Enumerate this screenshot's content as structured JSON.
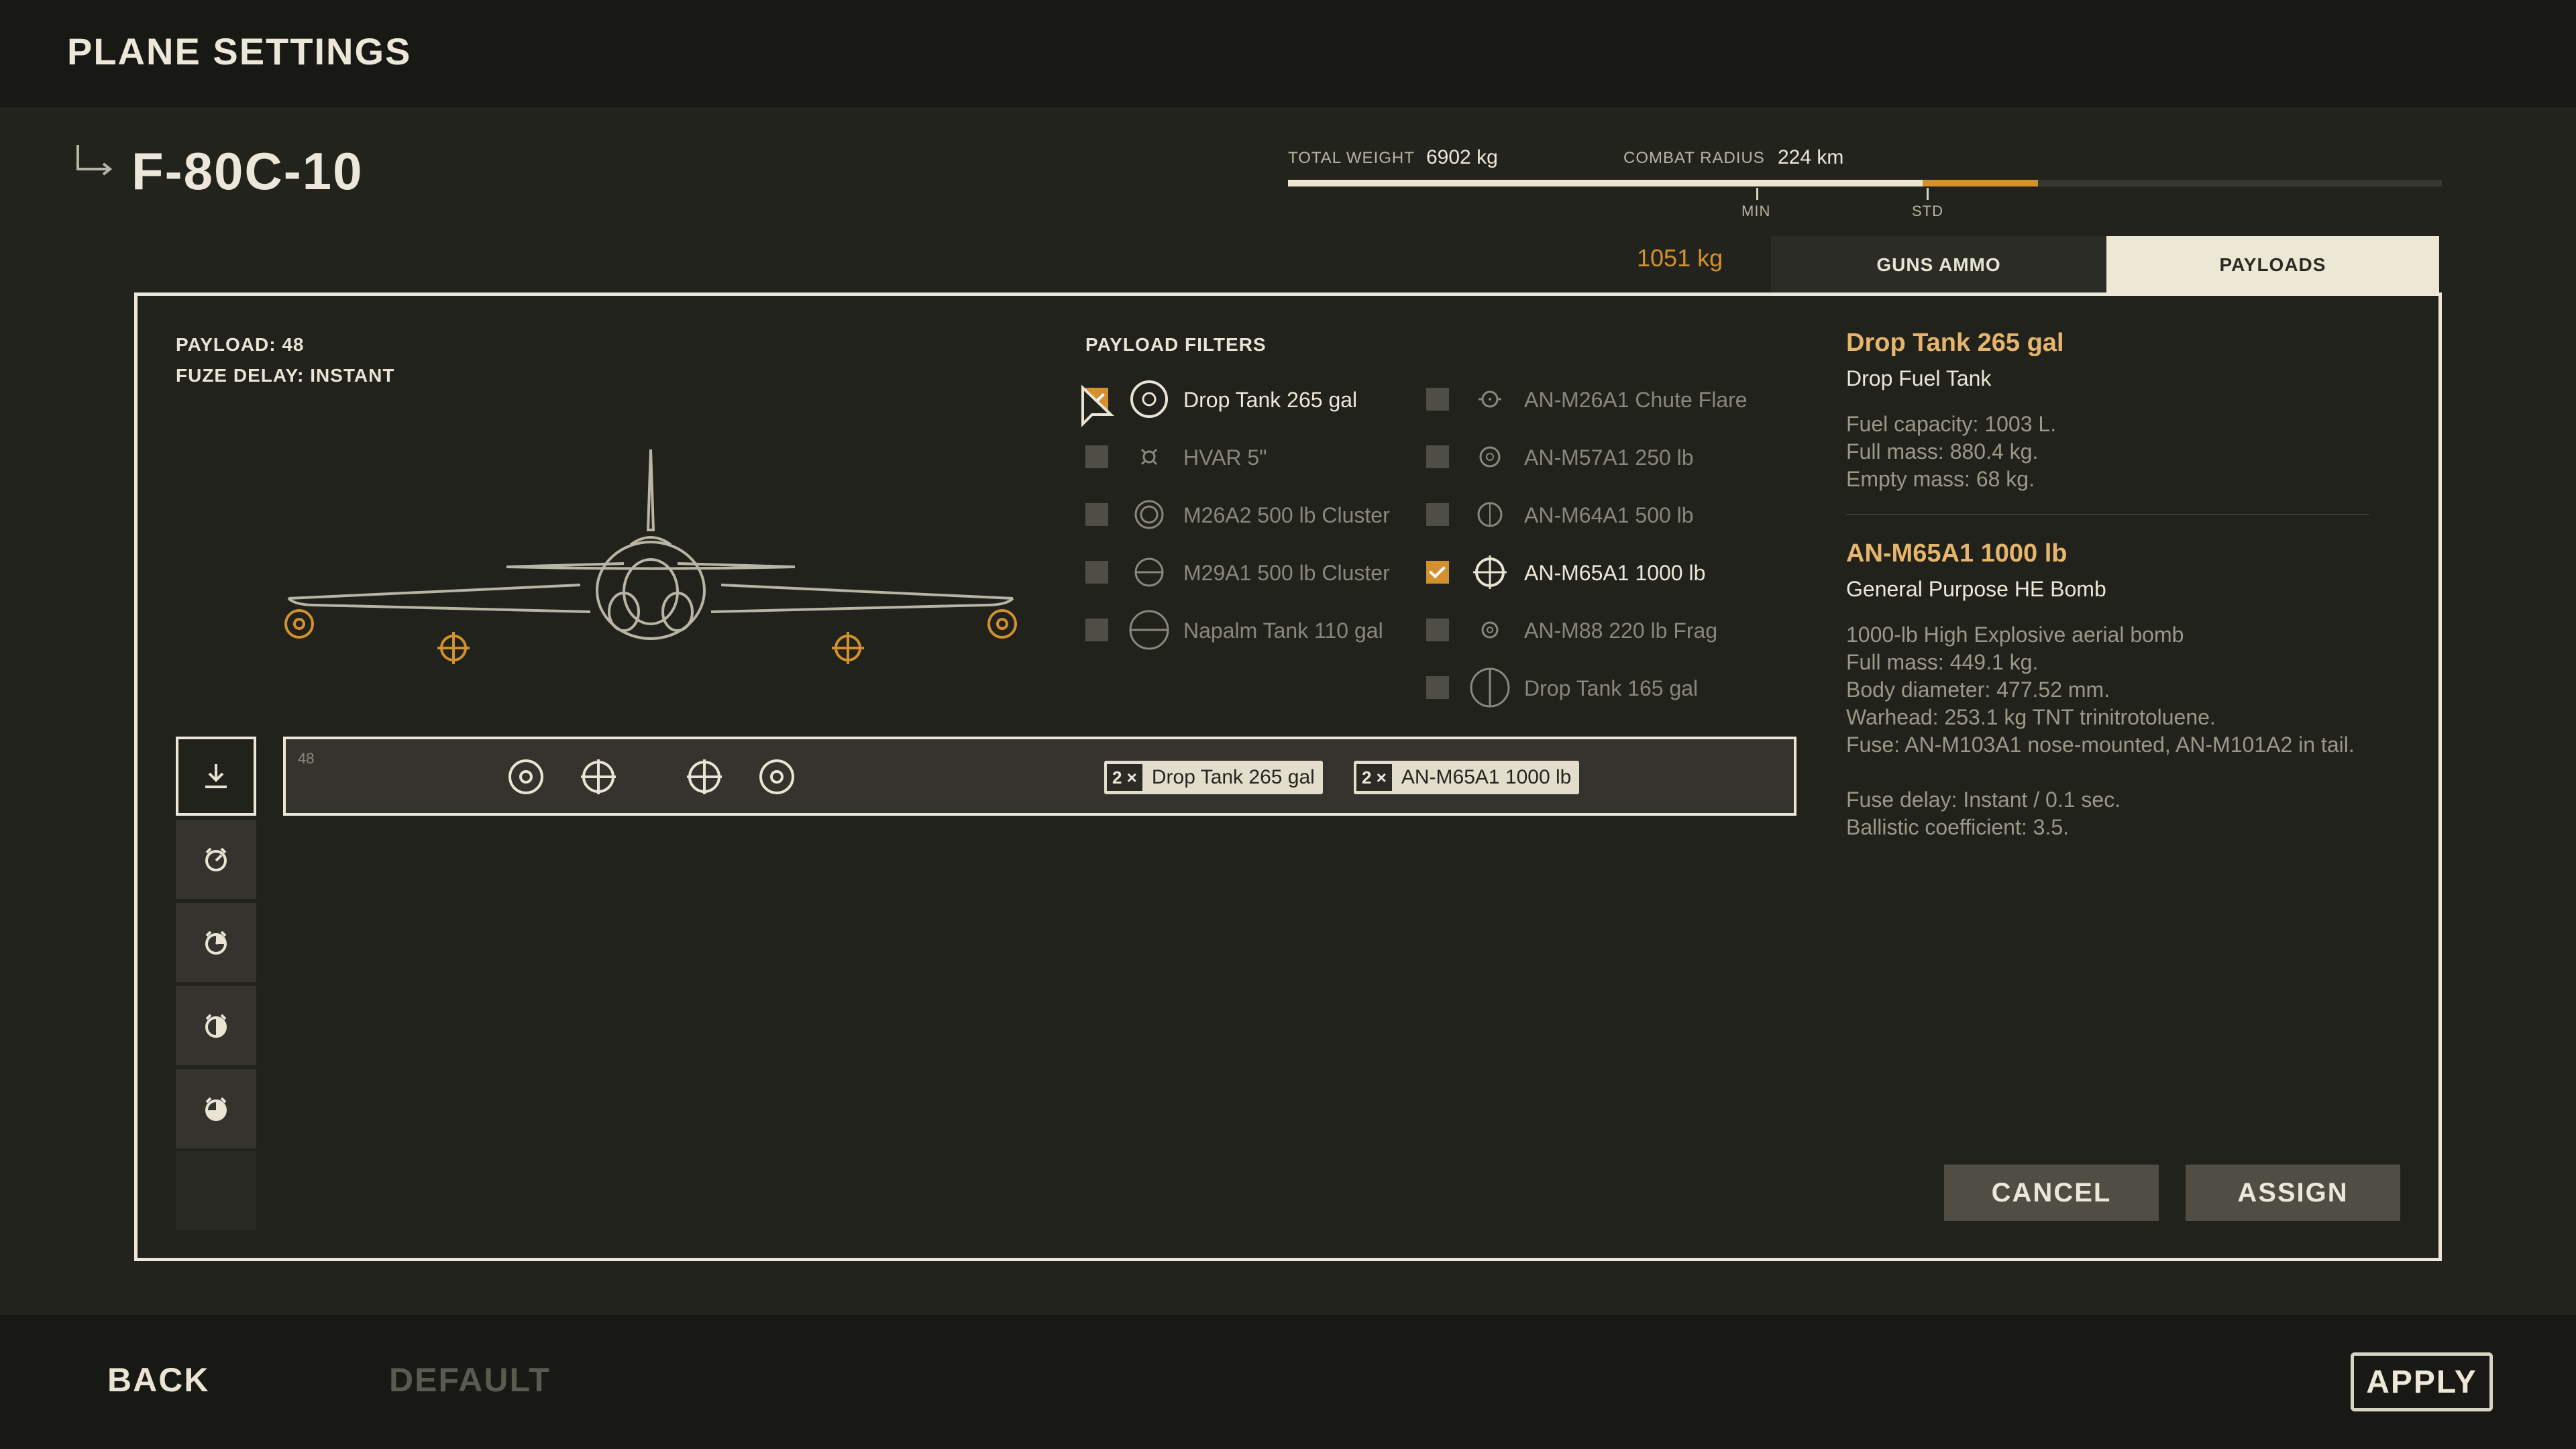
{
  "header": {
    "title": "PLANE SETTINGS"
  },
  "plane": {
    "name": "F-80C-10"
  },
  "stats": {
    "total_weight_label": "TOTAL WEIGHT",
    "total_weight_value": "6902 kg",
    "combat_radius_label": "COMBAT RADIUS",
    "combat_radius_value": "224 km",
    "min_label": "MIN",
    "std_label": "STD",
    "extra_weight": "1051 kg",
    "base_fill_fraction": 0.55,
    "extra_fill_fraction": 0.1
  },
  "tabs": {
    "guns_ammo": "GUNS AMMO",
    "payloads": "PAYLOADS"
  },
  "payload_info": {
    "payload": "PAYLOAD: 48",
    "fuze_delay": "FUZE DELAY: INSTANT"
  },
  "filters": {
    "title": "PAYLOAD FILTERS",
    "left": [
      {
        "label": "Drop Tank 265 gal",
        "checked": true,
        "icon": "drop-tank-icon"
      },
      {
        "label": "HVAR 5\"",
        "checked": false,
        "icon": "rocket-icon"
      },
      {
        "label": "M26A2 500 lb Cluster",
        "checked": false,
        "icon": "cluster-bomb-icon"
      },
      {
        "label": "M29A1 500 lb Cluster",
        "checked": false,
        "icon": "cluster-bomb-icon"
      },
      {
        "label": "Napalm Tank 110 gal",
        "checked": false,
        "icon": "napalm-tank-icon"
      }
    ],
    "right": [
      {
        "label": "AN-M26A1 Chute Flare",
        "checked": false,
        "icon": "flare-icon"
      },
      {
        "label": "AN-M57A1 250 lb",
        "checked": false,
        "icon": "bomb-icon"
      },
      {
        "label": "AN-M64A1 500 lb",
        "checked": false,
        "icon": "bomb-icon"
      },
      {
        "label": "AN-M65A1 1000 lb",
        "checked": true,
        "icon": "bomb-icon"
      },
      {
        "label": "AN-M88 220 lb Frag",
        "checked": false,
        "icon": "frag-bomb-icon"
      },
      {
        "label": "Drop Tank 165 gal",
        "checked": false,
        "icon": "drop-tank-icon"
      }
    ]
  },
  "loadout": {
    "slot_number": "48",
    "chips": [
      {
        "count": "2 ×",
        "label": "Drop Tank 265 gal"
      },
      {
        "count": "2 ×",
        "label": "AN-M65A1 1000 lb"
      }
    ]
  },
  "details": {
    "item1": {
      "title": "Drop Tank 265 gal",
      "subtitle": "Drop Fuel Tank",
      "lines": [
        "Fuel capacity: 1003 L.",
        "Full mass: 880.4 kg.",
        "Empty mass: 68 kg."
      ]
    },
    "item2": {
      "title": "AN-M65A1 1000 lb",
      "subtitle": "General Purpose HE Bomb",
      "lines": [
        "1000-lb High Explosive aerial bomb",
        "Full mass: 449.1 kg.",
        "Body diameter: 477.52 mm.",
        "Warhead: 253.1 kg TNT trinitrotoluene.",
        "Fuse: AN-M103A1 nose-mounted, AN-M101A2 in tail.",
        "Fuse delay: Instant / 0.1 sec.",
        "Ballistic coefficient: 3.5."
      ]
    }
  },
  "actions": {
    "cancel": "CANCEL",
    "assign": "ASSIGN"
  },
  "footer": {
    "back": "BACK",
    "default": "DEFAULT",
    "apply": "APPLY"
  },
  "colors": {
    "accent": "#d2912e",
    "highlight": "#e6b56c",
    "panel_border": "#ece7d8"
  }
}
